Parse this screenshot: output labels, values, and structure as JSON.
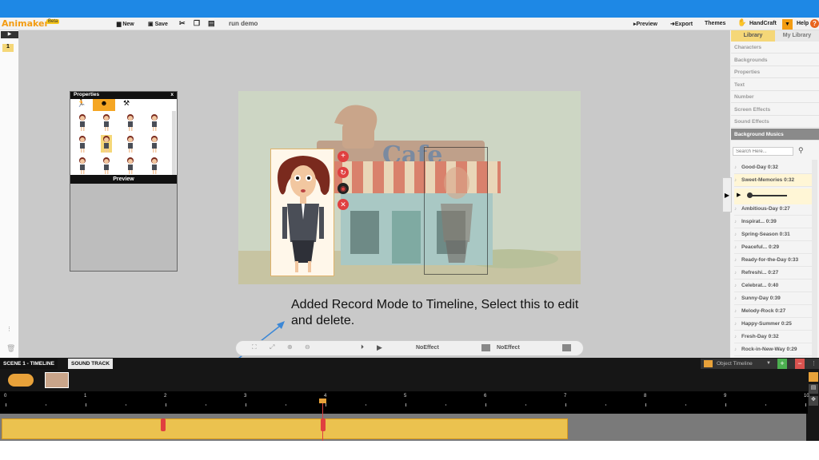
{
  "app": {
    "logo": "Animaker",
    "beta": "Beta",
    "project": "run demo"
  },
  "toolbar": {
    "new": "New",
    "save": "Save",
    "preview": "▸Preview",
    "export": "➜Export",
    "themes": "Themes",
    "handcraft": "HandCraft",
    "help": "Help"
  },
  "sidebar": {
    "tabs": [
      "Library",
      "My Library"
    ],
    "categories": [
      "Characters",
      "Backgrounds",
      "Properties",
      "Text",
      "Number",
      "Screen Effects",
      "Sound Effects",
      "Background Musics"
    ],
    "search_placeholder": "Search Here...",
    "songs": [
      "Good-Day 0:32",
      "Sweet-Memories 0:32",
      "Ambitious-Day 0:27",
      "Inspirat... 0:39",
      "Spring-Season 0:31",
      "Peaceful... 0:29",
      "Ready-for-the-Day 0:33",
      "Refreshi... 0:27",
      "Celebrat... 0:40",
      "Sunny-Day 0:39",
      "Melody-Rock 0:27",
      "Happy-Summer 0:25",
      "Fresh-Day 0:32",
      "Rock-in-New-Way 0:29"
    ]
  },
  "left": {
    "scene_number": "1"
  },
  "properties": {
    "title": "Properties",
    "close": "x",
    "preview": "Preview"
  },
  "scene": {
    "sign": "Cafe"
  },
  "caption": "Added Record Mode to Timeline, Select this to edit and delete.",
  "controls": {
    "effect1": "NoEffect",
    "effect2": "NoEffect"
  },
  "timeline": {
    "tab1": "SCENE 1 - TIMELINE",
    "tab2": "SOUND TRACK",
    "object_timeline": "Object Timeline",
    "ticks": [
      "0",
      "1",
      "2",
      "3",
      "4",
      "5",
      "6",
      "7",
      "8",
      "9",
      "10"
    ]
  },
  "colors": {
    "accent": "#1e88e5",
    "timeline_bar": "#ebc24f",
    "marker": "#e04040"
  }
}
